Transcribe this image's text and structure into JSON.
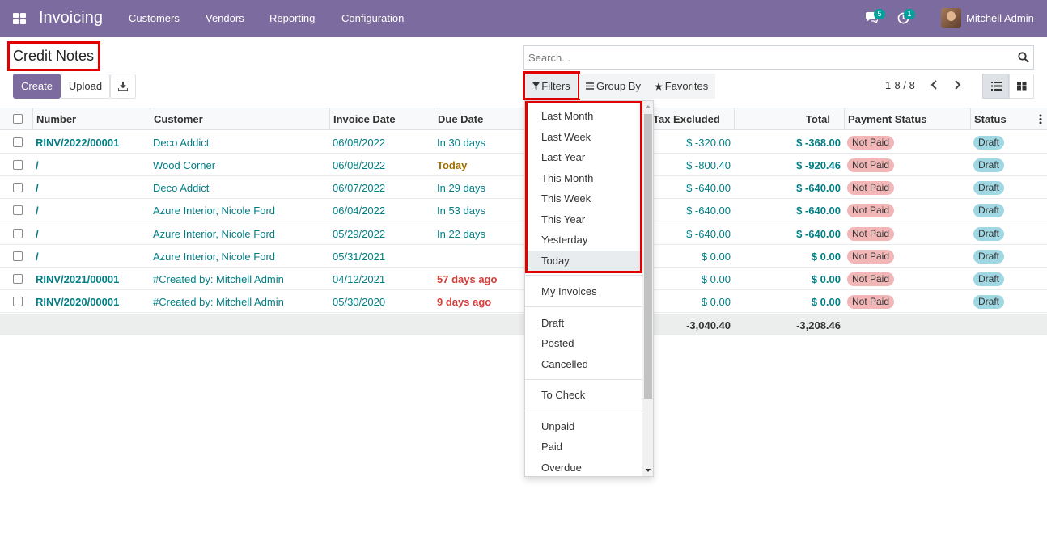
{
  "navbar": {
    "brand": "Invoicing",
    "menu": [
      "Customers",
      "Vendors",
      "Reporting",
      "Configuration"
    ],
    "messages_count": "5",
    "activities_count": "1",
    "user_name": "Mitchell Admin"
  },
  "control_panel": {
    "title": "Credit Notes",
    "create_label": "Create",
    "upload_label": "Upload",
    "search_placeholder": "Search...",
    "filters_label": "Filters",
    "group_by_label": "Group By",
    "favorites_label": "Favorites",
    "pager": "1-8 / 8"
  },
  "table": {
    "headers": {
      "number": "Number",
      "customer": "Customer",
      "invoice_date": "Invoice Date",
      "due_date": "Due Date",
      "tax_excluded": "Tax Excluded",
      "total": "Total",
      "payment_status": "Payment Status",
      "status": "Status"
    },
    "rows": [
      {
        "number": "RINV/2022/00001",
        "customer": "Deco Addict",
        "invoice_date": "06/08/2022",
        "due_date": "In 30 days",
        "due_style": "normal",
        "tax_excluded": "$ -320.00",
        "total": "$ -368.00",
        "payment_status": "Not Paid",
        "status": "Draft"
      },
      {
        "number": "/",
        "customer": "Wood Corner",
        "invoice_date": "06/08/2022",
        "due_date": "Today",
        "due_style": "today",
        "tax_excluded": "$ -800.40",
        "total": "$ -920.46",
        "payment_status": "Not Paid",
        "status": "Draft"
      },
      {
        "number": "/",
        "customer": "Deco Addict",
        "invoice_date": "06/07/2022",
        "due_date": "In 29 days",
        "due_style": "normal",
        "tax_excluded": "$ -640.00",
        "total": "$ -640.00",
        "payment_status": "Not Paid",
        "status": "Draft"
      },
      {
        "number": "/",
        "customer": "Azure Interior, Nicole Ford",
        "invoice_date": "06/04/2022",
        "due_date": "In 53 days",
        "due_style": "normal",
        "tax_excluded": "$ -640.00",
        "total": "$ -640.00",
        "payment_status": "Not Paid",
        "status": "Draft"
      },
      {
        "number": "/",
        "customer": "Azure Interior, Nicole Ford",
        "invoice_date": "05/29/2022",
        "due_date": "In 22 days",
        "due_style": "normal",
        "tax_excluded": "$ -640.00",
        "total": "$ -640.00",
        "payment_status": "Not Paid",
        "status": "Draft"
      },
      {
        "number": "/",
        "customer": "Azure Interior, Nicole Ford",
        "invoice_date": "05/31/2021",
        "due_date": "",
        "due_style": "normal",
        "tax_excluded": "$ 0.00",
        "total": "$ 0.00",
        "payment_status": "Not Paid",
        "status": "Draft"
      },
      {
        "number": "RINV/2021/00001",
        "customer": "#Created by: Mitchell Admin",
        "invoice_date": "04/12/2021",
        "due_date": "57 days ago",
        "due_style": "late",
        "tax_excluded": "$ 0.00",
        "total": "$ 0.00",
        "payment_status": "Not Paid",
        "status": "Draft"
      },
      {
        "number": "RINV/2020/00001",
        "customer": "#Created by: Mitchell Admin",
        "invoice_date": "05/30/2020",
        "due_date": "9 days ago",
        "due_style": "late",
        "tax_excluded": "$ 0.00",
        "total": "$ 0.00",
        "payment_status": "Not Paid",
        "status": "Draft"
      }
    ],
    "footer": {
      "tax_excluded_sum": "-3,040.40",
      "total_sum": "-3,208.46"
    }
  },
  "filters_dropdown": {
    "date_items": [
      "Last Month",
      "Last Week",
      "Last Year",
      "This Month",
      "This Week",
      "This Year",
      "Yesterday",
      "Today"
    ],
    "active_item": "Today",
    "group2": [
      "My Invoices"
    ],
    "group3": [
      "Draft",
      "Posted",
      "Cancelled"
    ],
    "group4": [
      "To Check"
    ],
    "group5": [
      "Unpaid",
      "Paid",
      "Overdue"
    ]
  },
  "colors": {
    "navbar": "#7c6b9e",
    "link": "#017e84",
    "highlight_border": "#e00000",
    "not_paid": "#f2b6b6",
    "draft": "#9fd7e3"
  }
}
